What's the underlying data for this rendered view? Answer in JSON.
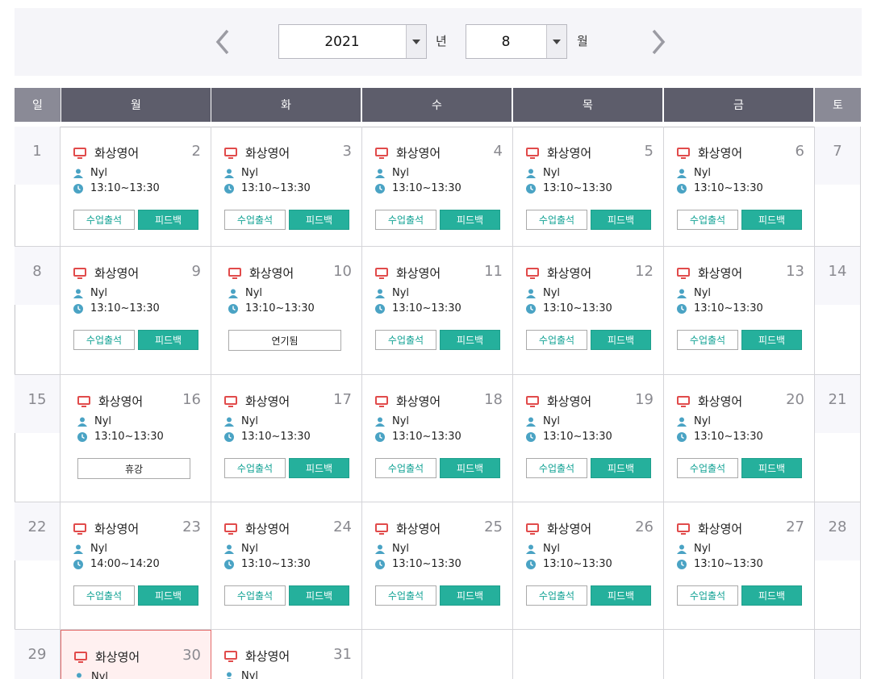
{
  "header": {
    "year": "2021",
    "year_unit": "년",
    "month": "8",
    "month_unit": "월"
  },
  "weekdays": [
    "일",
    "월",
    "화",
    "수",
    "목",
    "금",
    "토"
  ],
  "lesson": {
    "title": "화상영어",
    "teacher": "Nyl",
    "attend_label": "수업출석",
    "feedback_label": "피드백"
  },
  "weeks": [
    {
      "sun": "1",
      "sat": "7",
      "days": [
        {
          "day": "2",
          "time": "13:10~13:30"
        },
        {
          "day": "3",
          "time": "13:10~13:30"
        },
        {
          "day": "4",
          "time": "13:10~13:30"
        },
        {
          "day": "5",
          "time": "13:10~13:30"
        },
        {
          "day": "6",
          "time": "13:10~13:30"
        }
      ]
    },
    {
      "sun": "8",
      "sat": "14",
      "days": [
        {
          "day": "9",
          "time": "13:10~13:30"
        },
        {
          "day": "10",
          "time": "13:10~13:30",
          "status": "연기됨"
        },
        {
          "day": "11",
          "time": "13:10~13:30"
        },
        {
          "day": "12",
          "time": "13:10~13:30"
        },
        {
          "day": "13",
          "time": "13:10~13:30"
        }
      ]
    },
    {
      "sun": "15",
      "sat": "21",
      "days": [
        {
          "day": "16",
          "time": "13:10~13:30",
          "status": "휴강"
        },
        {
          "day": "17",
          "time": "13:10~13:30"
        },
        {
          "day": "18",
          "time": "13:10~13:30"
        },
        {
          "day": "19",
          "time": "13:10~13:30"
        },
        {
          "day": "20",
          "time": "13:10~13:30"
        }
      ]
    },
    {
      "sun": "22",
      "sat": "28",
      "days": [
        {
          "day": "23",
          "time": "14:00~14:20"
        },
        {
          "day": "24",
          "time": "13:10~13:30"
        },
        {
          "day": "25",
          "time": "13:10~13:30"
        },
        {
          "day": "26",
          "time": "13:10~13:30"
        },
        {
          "day": "27",
          "time": "13:10~13:30"
        }
      ]
    },
    {
      "sun": "29",
      "sat": "",
      "days": [
        {
          "day": "30",
          "time": "",
          "today": true
        },
        {
          "day": "31",
          "time": ""
        },
        {
          "day": ""
        },
        {
          "day": ""
        },
        {
          "day": ""
        }
      ]
    }
  ],
  "colors": {
    "header": "#5d5d6b",
    "header_weekend": "#8a8a96",
    "accent": "#25b09c",
    "monitor_icon": "#e14b4b",
    "info_icon": "#4aa3c4",
    "today_bg": "#fff0f0"
  }
}
